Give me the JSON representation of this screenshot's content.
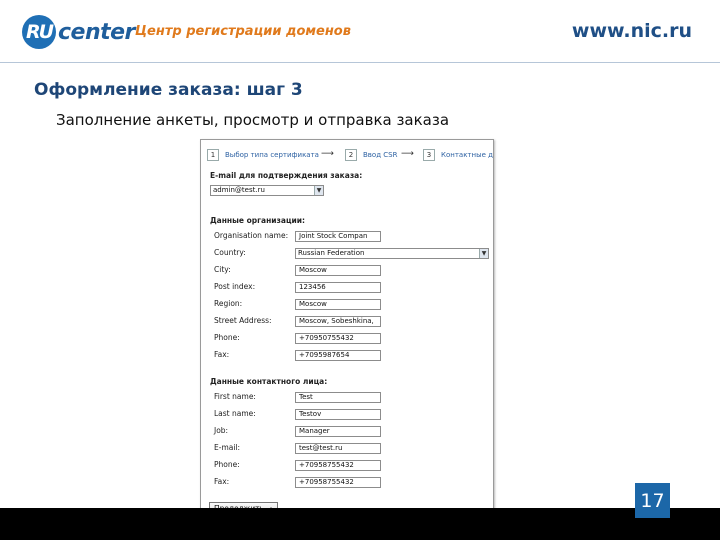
{
  "header": {
    "logo_badge": "RU",
    "logo_text": "center",
    "tagline": "Центр регистрации доменов",
    "site_url": "www.nic.ru"
  },
  "slide": {
    "title": "Оформление заказа: шаг 3",
    "subtitle": "Заполнение анкеты, просмотр и отправка заказа",
    "page_number": "17"
  },
  "colors": {
    "brand_blue": "#1f5e9c",
    "brand_orange": "#e07a1c",
    "link_blue": "#2e62a3"
  },
  "form": {
    "steps": [
      {
        "num": "1",
        "label": "Выбор типа сертификата"
      },
      {
        "num": "2",
        "label": "Ввод CSR"
      },
      {
        "num": "3",
        "label": "Контактные д"
      }
    ],
    "email_heading": "E-mail для подтверждения заказа:",
    "email_select": "admin@test.ru",
    "org_heading": "Данные организации:",
    "org_fields": [
      {
        "label": "Organisation name:",
        "value": "Joint Stock Compan"
      },
      {
        "label": "Country:",
        "value": "Russian Federation"
      },
      {
        "label": "City:",
        "value": "Moscow"
      },
      {
        "label": "Post index:",
        "value": "123456"
      },
      {
        "label": "Region:",
        "value": "Moscow"
      },
      {
        "label": "Street Address:",
        "value": "Moscow, Sobeshkina,"
      },
      {
        "label": "Phone:",
        "value": "+70950755432"
      },
      {
        "label": "Fax:",
        "value": "+7095987654"
      }
    ],
    "contact_heading": "Данные контактного лица:",
    "contact_fields": [
      {
        "label": "First name:",
        "value": "Test"
      },
      {
        "label": "Last name:",
        "value": "Testov"
      },
      {
        "label": "Job:",
        "value": "Manager"
      },
      {
        "label": "E-mail:",
        "value": "test@test.ru"
      },
      {
        "label": "Phone:",
        "value": "+70958755432"
      },
      {
        "label": "Fax:",
        "value": "+70958755432"
      }
    ],
    "submit_label": "Продолжить →"
  }
}
